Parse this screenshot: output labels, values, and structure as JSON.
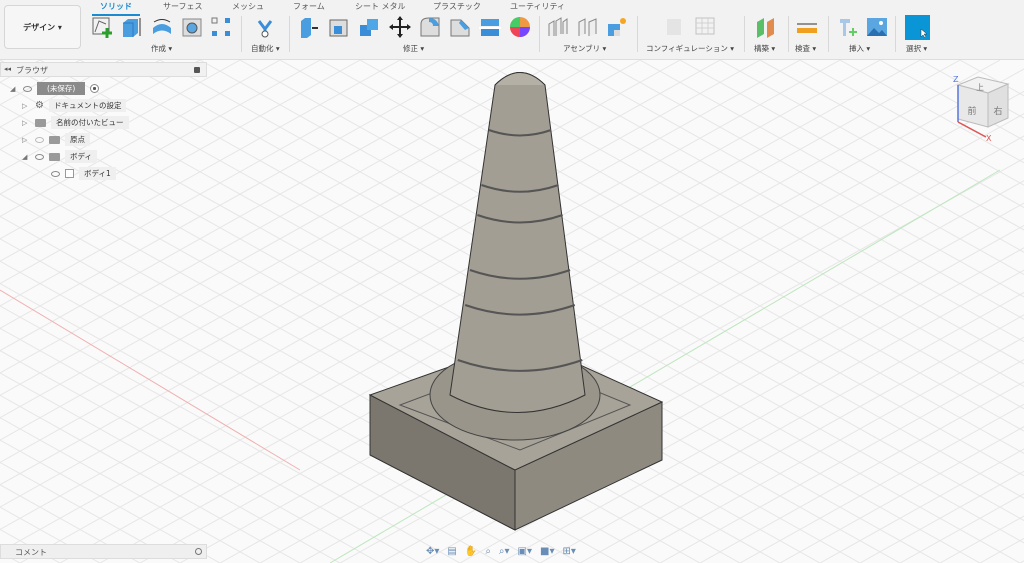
{
  "workspace": "デザイン ▾",
  "tabs": [
    "ソリッド",
    "サーフェス",
    "メッシュ",
    "フォーム",
    "シート メタル",
    "プラスチック",
    "ユーティリティ"
  ],
  "groups": {
    "create": "作成 ▾",
    "automate": "自動化 ▾",
    "modify": "修正 ▾",
    "assembly": "アセンブリ ▾",
    "configuration": "コンフィギュレーション ▾",
    "construct": "構築 ▾",
    "inspect": "検査 ▾",
    "insert": "挿入 ▾",
    "select": "選択 ▾"
  },
  "browser": {
    "title": "ブラウザ",
    "root": "(未保存)",
    "items": [
      "ドキュメントの設定",
      "名前の付いたビュー",
      "原点",
      "ボディ",
      "ボディ1"
    ]
  },
  "comment": "コメント",
  "viewcube": {
    "top": "上",
    "front": "前",
    "right": "右",
    "z": "Z",
    "x": "X"
  },
  "colors": {
    "accent": "#1a8bd0",
    "select": "#0a96d6"
  }
}
